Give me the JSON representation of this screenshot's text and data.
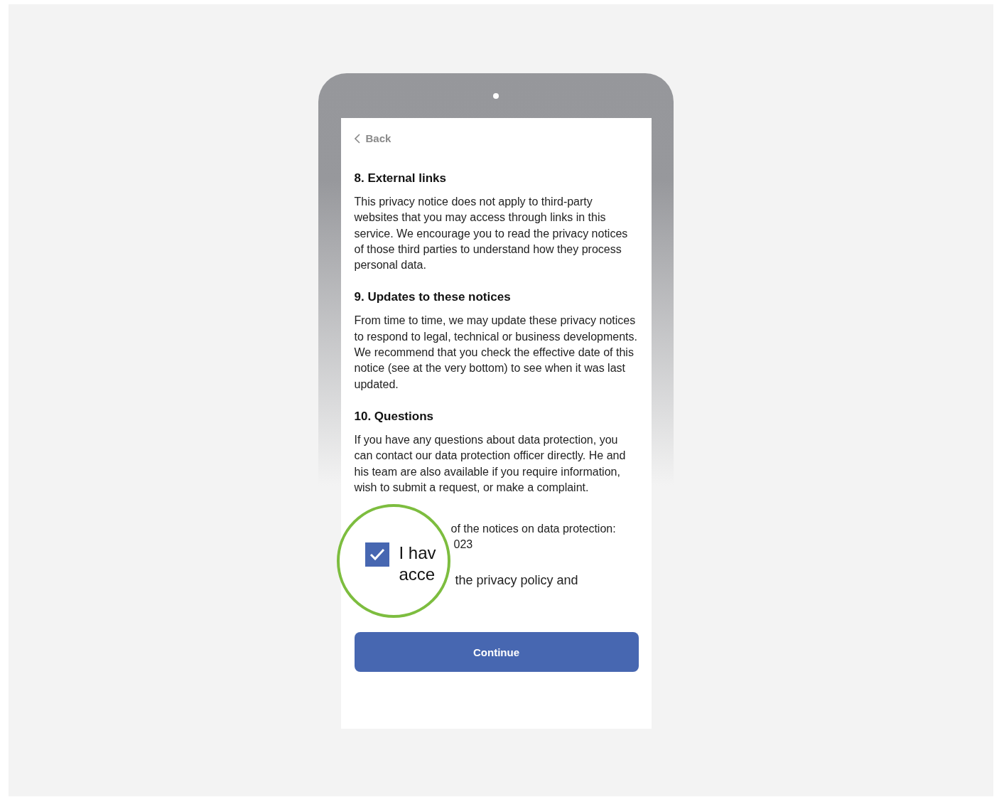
{
  "back": {
    "label": "Back"
  },
  "sections": [
    {
      "heading": "8. External links",
      "body": "This privacy notice does not apply to third-party websites that you may access through links in this service. We encourage you to read the privacy notices of those third parties to understand how they process personal data."
    },
    {
      "heading": "9. Updates to these notices",
      "body": "From time to time, we may update these privacy notices to respond to legal, technical or business developments. We recommend that you check the effective date of this notice (see at the very bottom) to see when it was last updated."
    },
    {
      "heading": "10. Questions",
      "body": "If you have any questions about data protection, you can contact our data protection officer directly. He and his team are also available if you require information, wish to submit a request, or make a complaint."
    }
  ],
  "effective_date": {
    "line_1": "of the notices on data protection:",
    "line_2": "023"
  },
  "consent": {
    "text_line": "the privacy policy and"
  },
  "magnifier": {
    "checkbox_checked": true,
    "line_1": "I hav",
    "line_2": "acce"
  },
  "continue_button": {
    "label": "Continue"
  }
}
